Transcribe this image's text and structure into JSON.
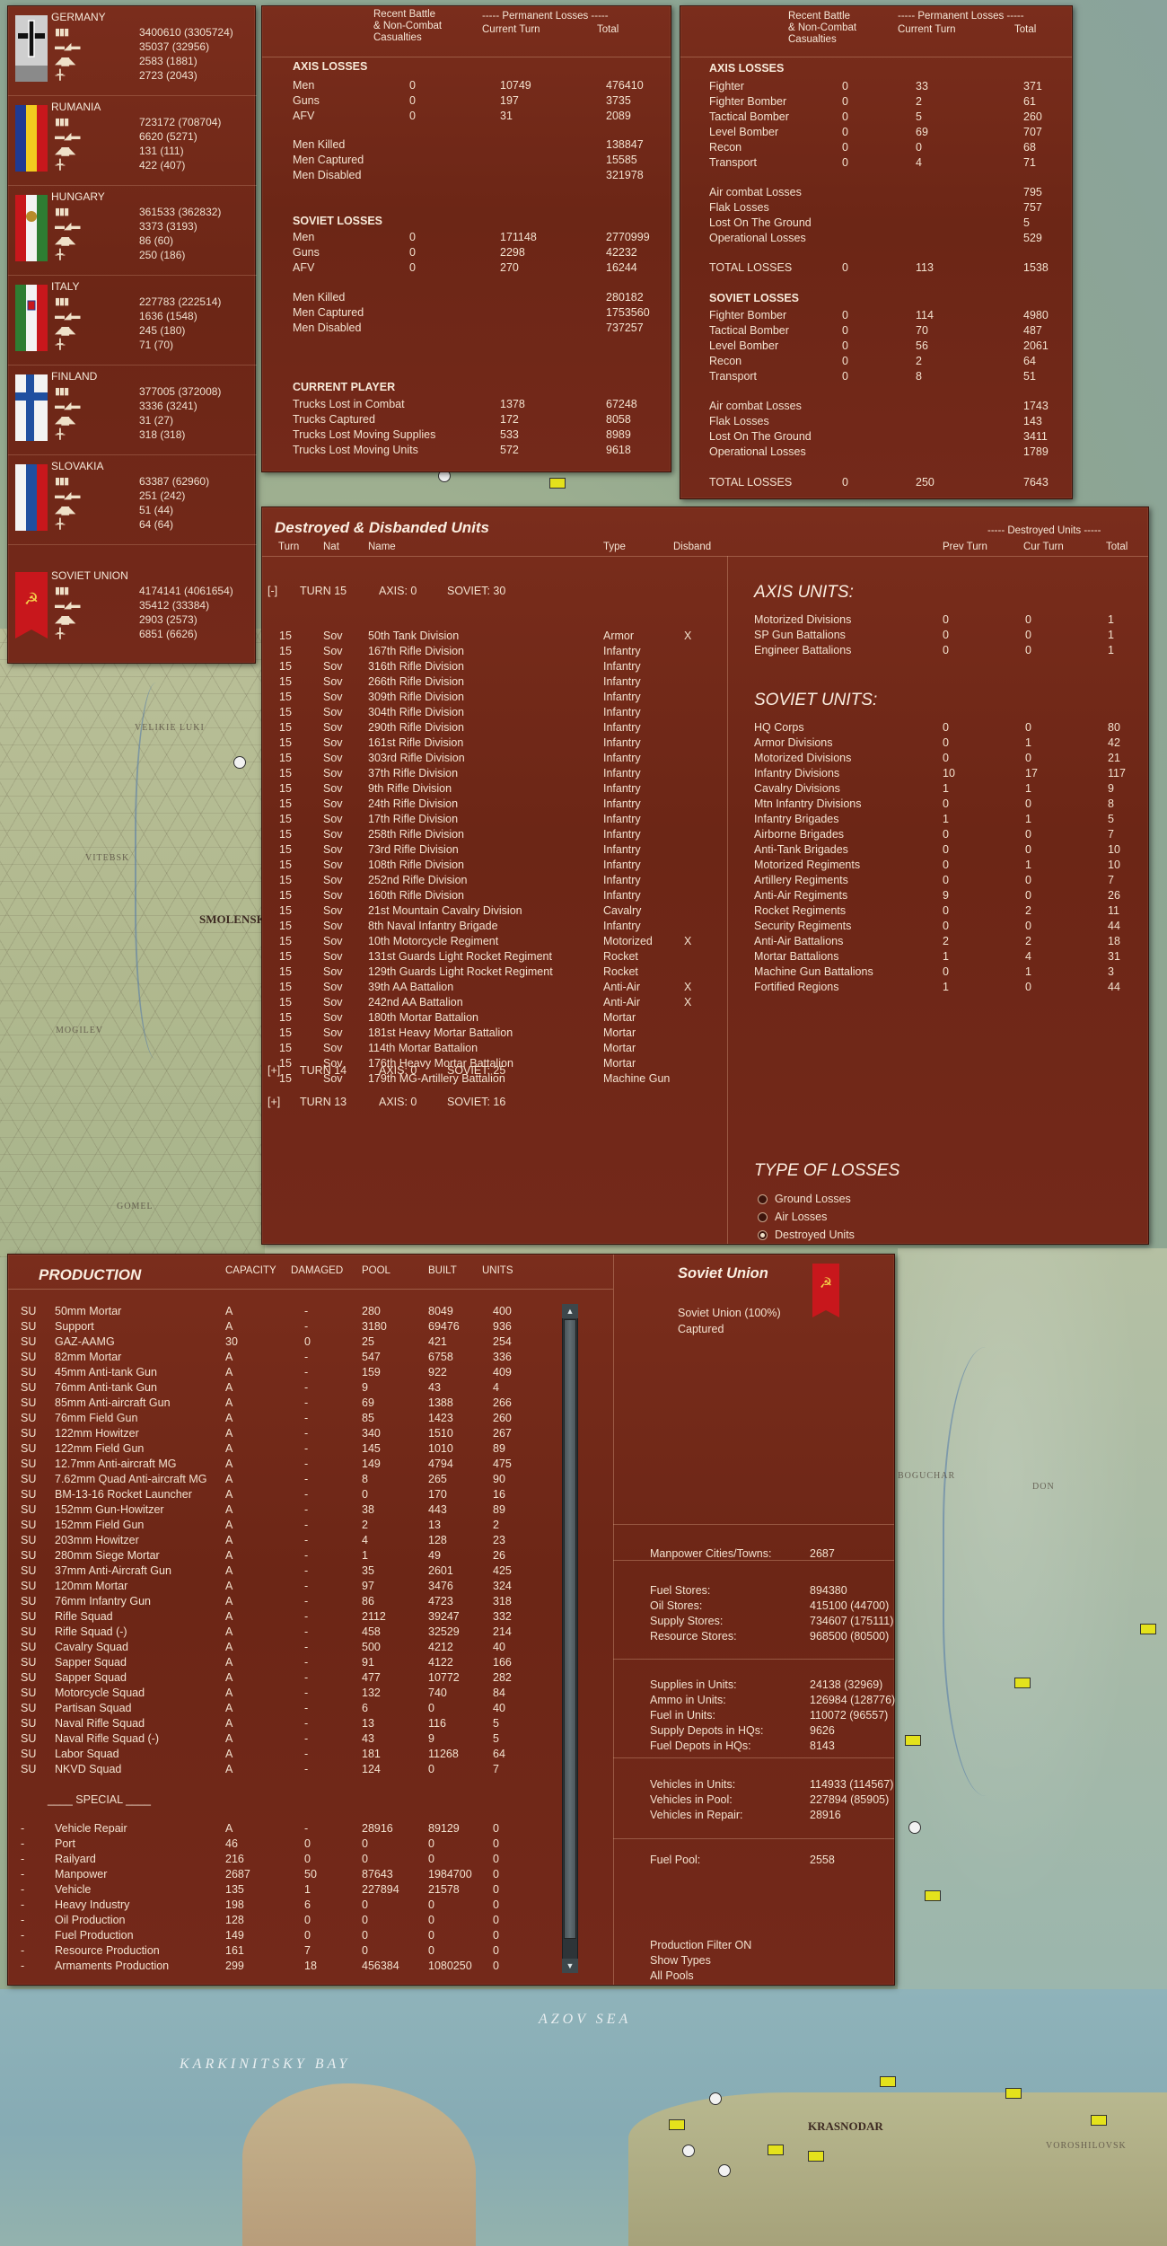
{
  "nations": [
    {
      "name": "GERMANY",
      "flag": "germany",
      "values": [
        "3400610 (3305724)",
        "35037 (32956)",
        "2583 (1881)",
        "2723 (2043)"
      ]
    },
    {
      "name": "RUMANIA",
      "flag": "rumania",
      "values": [
        "723172 (708704)",
        "6620 (5271)",
        "131 (111)",
        "422 (407)"
      ]
    },
    {
      "name": "HUNGARY",
      "flag": "hungary",
      "values": [
        "361533 (362832)",
        "3373 (3193)",
        "86 (60)",
        "250 (186)"
      ]
    },
    {
      "name": "ITALY",
      "flag": "italy",
      "values": [
        "227783 (222514)",
        "1636 (1548)",
        "245 (180)",
        "71 (70)"
      ]
    },
    {
      "name": "FINLAND",
      "flag": "finland",
      "values": [
        "377005 (372008)",
        "3336 (3241)",
        "31 (27)",
        "318 (318)"
      ]
    },
    {
      "name": "SLOVAKIA",
      "flag": "slovakia",
      "values": [
        "63387 (62960)",
        "251 (242)",
        "51 (44)",
        "64 (64)"
      ]
    },
    {
      "name": "SOVIET UNION",
      "flag": "soviet",
      "values": [
        "4174141 (4061654)",
        "35412 (33384)",
        "2903 (2573)",
        "6851 (6626)"
      ]
    }
  ],
  "ground_losses": {
    "header": {
      "recent": "Recent Battle\n& Non-Combat\nCasualties",
      "perm": "----- Permanent Losses -----",
      "cur": "Current Turn",
      "total": "Total"
    },
    "axis_title": "AXIS LOSSES",
    "axis_rows": [
      [
        "Men",
        "0",
        "10749",
        "476410"
      ],
      [
        "Guns",
        "0",
        "197",
        "3735"
      ],
      [
        "AFV",
        "0",
        "31",
        "2089"
      ]
    ],
    "axis_men": [
      [
        "Men Killed",
        "138847"
      ],
      [
        "Men Captured",
        "15585"
      ],
      [
        "Men Disabled",
        "321978"
      ]
    ],
    "soviet_title": "SOVIET LOSSES",
    "soviet_rows": [
      [
        "Men",
        "0",
        "171148",
        "2770999"
      ],
      [
        "Guns",
        "0",
        "2298",
        "42232"
      ],
      [
        "AFV",
        "0",
        "270",
        "16244"
      ]
    ],
    "soviet_men": [
      [
        "Men Killed",
        "280182"
      ],
      [
        "Men Captured",
        "1753560"
      ],
      [
        "Men Disabled",
        "737257"
      ]
    ],
    "player_title": "CURRENT PLAYER",
    "player_rows": [
      [
        "Trucks Lost in Combat",
        "1378",
        "67248"
      ],
      [
        "Trucks Captured",
        "172",
        "8058"
      ],
      [
        "Trucks Lost Moving Supplies",
        "533",
        "8989"
      ],
      [
        "Trucks Lost Moving Units",
        "572",
        "9618"
      ]
    ]
  },
  "air_losses": {
    "header": {
      "recent": "Recent Battle\n& Non-Combat\nCasualties",
      "perm": "----- Permanent Losses -----",
      "cur": "Current Turn",
      "total": "Total"
    },
    "axis_title": "AXIS LOSSES",
    "axis_rows": [
      [
        "Fighter",
        "0",
        "33",
        "371"
      ],
      [
        "Fighter Bomber",
        "0",
        "2",
        "61"
      ],
      [
        "Tactical Bomber",
        "0",
        "5",
        "260"
      ],
      [
        "Level Bomber",
        "0",
        "69",
        "707"
      ],
      [
        "Recon",
        "0",
        "0",
        "68"
      ],
      [
        "Transport",
        "0",
        "4",
        "71"
      ]
    ],
    "axis_sub": [
      [
        "Air combat Losses",
        "795"
      ],
      [
        "Flak Losses",
        "757"
      ],
      [
        "Lost On The Ground",
        "5"
      ],
      [
        "Operational Losses",
        "529"
      ]
    ],
    "axis_total": [
      "TOTAL LOSSES",
      "0",
      "113",
      "1538"
    ],
    "soviet_title": "SOVIET LOSSES",
    "soviet_rows": [
      [
        "Fighter Bomber",
        "0",
        "114",
        "4980"
      ],
      [
        "Tactical Bomber",
        "0",
        "70",
        "487"
      ],
      [
        "Level Bomber",
        "0",
        "56",
        "2061"
      ],
      [
        "Recon",
        "0",
        "2",
        "64"
      ],
      [
        "Transport",
        "0",
        "8",
        "51"
      ]
    ],
    "soviet_sub": [
      [
        "Air combat Losses",
        "1743"
      ],
      [
        "Flak Losses",
        "143"
      ],
      [
        "Lost On The Ground",
        "3411"
      ],
      [
        "Operational Losses",
        "1789"
      ]
    ],
    "soviet_total": [
      "TOTAL LOSSES",
      "0",
      "250",
      "7643"
    ]
  },
  "destroyed": {
    "title": "Destroyed & Disbanded Units",
    "cols": {
      "turn": "Turn",
      "nat": "Nat",
      "name": "Name",
      "type": "Type",
      "disband": "Disband"
    },
    "turn15": {
      "toggle": "[-]",
      "label": "TURN 15",
      "axis": "AXIS: 0",
      "soviet": "SOVIET: 30"
    },
    "units": [
      [
        "15",
        "Sov",
        "50th Tank Division",
        "Armor",
        "X"
      ],
      [
        "15",
        "Sov",
        "167th Rifle Division",
        "Infantry",
        ""
      ],
      [
        "15",
        "Sov",
        "316th Rifle Division",
        "Infantry",
        ""
      ],
      [
        "15",
        "Sov",
        "266th Rifle Division",
        "Infantry",
        ""
      ],
      [
        "15",
        "Sov",
        "309th Rifle Division",
        "Infantry",
        ""
      ],
      [
        "15",
        "Sov",
        "304th Rifle Division",
        "Infantry",
        ""
      ],
      [
        "15",
        "Sov",
        "290th Rifle Division",
        "Infantry",
        ""
      ],
      [
        "15",
        "Sov",
        "161st Rifle Division",
        "Infantry",
        ""
      ],
      [
        "15",
        "Sov",
        "303rd Rifle Division",
        "Infantry",
        ""
      ],
      [
        "15",
        "Sov",
        "37th Rifle Division",
        "Infantry",
        ""
      ],
      [
        "15",
        "Sov",
        "9th Rifle Division",
        "Infantry",
        ""
      ],
      [
        "15",
        "Sov",
        "24th Rifle Division",
        "Infantry",
        ""
      ],
      [
        "15",
        "Sov",
        "17th Rifle Division",
        "Infantry",
        ""
      ],
      [
        "15",
        "Sov",
        "258th Rifle Division",
        "Infantry",
        ""
      ],
      [
        "15",
        "Sov",
        "73rd Rifle Division",
        "Infantry",
        ""
      ],
      [
        "15",
        "Sov",
        "108th Rifle Division",
        "Infantry",
        ""
      ],
      [
        "15",
        "Sov",
        "252nd Rifle Division",
        "Infantry",
        ""
      ],
      [
        "15",
        "Sov",
        "160th Rifle Division",
        "Infantry",
        ""
      ],
      [
        "15",
        "Sov",
        "21st Mountain Cavalry Division",
        "Cavalry",
        ""
      ],
      [
        "15",
        "Sov",
        "8th Naval Infantry Brigade",
        "Infantry",
        ""
      ],
      [
        "15",
        "Sov",
        "10th Motorcycle Regiment",
        "Motorized",
        "X"
      ],
      [
        "15",
        "Sov",
        "131st Guards Light Rocket Regiment",
        "Rocket",
        ""
      ],
      [
        "15",
        "Sov",
        "129th Guards Light Rocket Regiment",
        "Rocket",
        ""
      ],
      [
        "15",
        "Sov",
        "39th AA Battalion",
        "Anti-Air",
        "X"
      ],
      [
        "15",
        "Sov",
        "242nd AA Battalion",
        "Anti-Air",
        "X"
      ],
      [
        "15",
        "Sov",
        "180th Mortar Battalion",
        "Mortar",
        ""
      ],
      [
        "15",
        "Sov",
        "181st Heavy Mortar Battalion",
        "Mortar",
        ""
      ],
      [
        "15",
        "Sov",
        "114th Mortar Battalion",
        "Mortar",
        ""
      ],
      [
        "15",
        "Sov",
        "176th Heavy Mortar Battalion",
        "Mortar",
        ""
      ],
      [
        "15",
        "Sov",
        "179th MG-Artillery Battalion",
        "Machine Gun",
        ""
      ]
    ],
    "turn14": {
      "toggle": "[+]",
      "label": "TURN 14",
      "axis": "AXIS: 0",
      "soviet": "SOVIET: 25"
    },
    "turn13": {
      "toggle": "[+]",
      "label": "TURN 13",
      "axis": "AXIS: 0",
      "soviet": "SOVIET: 16"
    },
    "summary_header": {
      "title": "----- Destroyed Units -----",
      "prev": "Prev Turn",
      "cur": "Cur Turn",
      "total": "Total"
    },
    "axis_units_title": "AXIS UNITS:",
    "axis_units": [
      [
        "Motorized Divisions",
        "0",
        "0",
        "1"
      ],
      [
        "SP Gun Battalions",
        "0",
        "0",
        "1"
      ],
      [
        "Engineer Battalions",
        "0",
        "0",
        "1"
      ]
    ],
    "soviet_units_title": "SOVIET UNITS:",
    "soviet_units": [
      [
        "HQ Corps",
        "0",
        "0",
        "80"
      ],
      [
        "Armor Divisions",
        "0",
        "1",
        "42"
      ],
      [
        "Motorized Divisions",
        "0",
        "0",
        "21"
      ],
      [
        "Infantry Divisions",
        "10",
        "17",
        "117"
      ],
      [
        "Cavalry Divisions",
        "1",
        "1",
        "9"
      ],
      [
        "Mtn Infantry Divisions",
        "0",
        "0",
        "8"
      ],
      [
        "Infantry Brigades",
        "1",
        "1",
        "5"
      ],
      [
        "Airborne Brigades",
        "0",
        "0",
        "7"
      ],
      [
        "Anti-Tank Brigades",
        "0",
        "0",
        "10"
      ],
      [
        "Motorized Regiments",
        "0",
        "1",
        "10"
      ],
      [
        "Artillery Regiments",
        "0",
        "0",
        "7"
      ],
      [
        "Anti-Air Regiments",
        "9",
        "0",
        "26"
      ],
      [
        "Rocket Regiments",
        "0",
        "2",
        "11"
      ],
      [
        "Security Regiments",
        "0",
        "0",
        "44"
      ],
      [
        "Anti-Air Battalions",
        "2",
        "2",
        "18"
      ],
      [
        "Mortar Battalions",
        "1",
        "4",
        "31"
      ],
      [
        "Machine Gun Battalions",
        "0",
        "1",
        "3"
      ],
      [
        "Fortified Regions",
        "1",
        "0",
        "44"
      ]
    ],
    "loss_types_title": "TYPE OF LOSSES",
    "loss_types": [
      {
        "label": "Ground Losses",
        "selected": false
      },
      {
        "label": "Air Losses",
        "selected": false
      },
      {
        "label": "Destroyed Units",
        "selected": true
      }
    ]
  },
  "production": {
    "title": "PRODUCTION",
    "cols": {
      "capacity": "CAPACITY",
      "damaged": "DAMAGED",
      "pool": "POOL",
      "built": "BUILT",
      "units": "UNITS"
    },
    "items": [
      [
        "SU",
        "50mm Mortar",
        "A",
        "-",
        "280",
        "8049",
        "400"
      ],
      [
        "SU",
        "Support",
        "A",
        "-",
        "3180",
        "69476",
        "936"
      ],
      [
        "SU",
        "GAZ-AAMG",
        "30",
        "0",
        "25",
        "421",
        "254"
      ],
      [
        "SU",
        "82mm Mortar",
        "A",
        "-",
        "547",
        "6758",
        "336"
      ],
      [
        "SU",
        "45mm Anti-tank Gun",
        "A",
        "-",
        "159",
        "922",
        "409"
      ],
      [
        "SU",
        "76mm Anti-tank Gun",
        "A",
        "-",
        "9",
        "43",
        "4"
      ],
      [
        "SU",
        "85mm Anti-aircraft Gun",
        "A",
        "-",
        "69",
        "1388",
        "266"
      ],
      [
        "SU",
        "76mm Field Gun",
        "A",
        "-",
        "85",
        "1423",
        "260"
      ],
      [
        "SU",
        "122mm Howitzer",
        "A",
        "-",
        "340",
        "1510",
        "267"
      ],
      [
        "SU",
        "122mm Field Gun",
        "A",
        "-",
        "145",
        "1010",
        "89"
      ],
      [
        "SU",
        "12.7mm Anti-aircraft MG",
        "A",
        "-",
        "149",
        "4794",
        "475"
      ],
      [
        "SU",
        "7.62mm Quad Anti-aircraft MG",
        "A",
        "-",
        "8",
        "265",
        "90"
      ],
      [
        "SU",
        "BM-13-16 Rocket Launcher",
        "A",
        "-",
        "0",
        "170",
        "16"
      ],
      [
        "SU",
        "152mm Gun-Howitzer",
        "A",
        "-",
        "38",
        "443",
        "89"
      ],
      [
        "SU",
        "152mm Field Gun",
        "A",
        "-",
        "2",
        "13",
        "2"
      ],
      [
        "SU",
        "203mm Howitzer",
        "A",
        "-",
        "4",
        "128",
        "23"
      ],
      [
        "SU",
        "280mm Siege Mortar",
        "A",
        "-",
        "1",
        "49",
        "26"
      ],
      [
        "SU",
        "37mm Anti-Aircraft Gun",
        "A",
        "-",
        "35",
        "2601",
        "425"
      ],
      [
        "SU",
        "120mm Mortar",
        "A",
        "-",
        "97",
        "3476",
        "324"
      ],
      [
        "SU",
        "76mm Infantry Gun",
        "A",
        "-",
        "86",
        "4723",
        "318"
      ],
      [
        "SU",
        "Rifle Squad",
        "A",
        "-",
        "2112",
        "39247",
        "332"
      ],
      [
        "SU",
        "Rifle Squad (-)",
        "A",
        "-",
        "458",
        "32529",
        "214"
      ],
      [
        "SU",
        "Cavalry Squad",
        "A",
        "-",
        "500",
        "4212",
        "40"
      ],
      [
        "SU",
        "Sapper Squad",
        "A",
        "-",
        "91",
        "4122",
        "166"
      ],
      [
        "SU",
        "Sapper Squad",
        "A",
        "-",
        "477",
        "10772",
        "282"
      ],
      [
        "SU",
        "Motorcycle Squad",
        "A",
        "-",
        "132",
        "740",
        "84"
      ],
      [
        "SU",
        "Partisan Squad",
        "A",
        "-",
        "6",
        "0",
        "40"
      ],
      [
        "SU",
        "Naval Rifle Squad",
        "A",
        "-",
        "13",
        "116",
        "5"
      ],
      [
        "SU",
        "Naval Rifle Squad (-)",
        "A",
        "-",
        "43",
        "9",
        "5"
      ],
      [
        "SU",
        "Labor Squad",
        "A",
        "-",
        "181",
        "11268",
        "64"
      ],
      [
        "SU",
        "NKVD Squad",
        "A",
        "-",
        "124",
        "0",
        "7"
      ]
    ],
    "special_title": "____ SPECIAL ____",
    "special": [
      [
        "-",
        "Vehicle Repair",
        "A",
        "-",
        "28916",
        "89129",
        "0"
      ],
      [
        "-",
        "Port",
        "46",
        "0",
        "0",
        "0",
        "0"
      ],
      [
        "-",
        "Railyard",
        "216",
        "0",
        "0",
        "0",
        "0"
      ],
      [
        "-",
        "Manpower",
        "2687",
        "50",
        "87643",
        "1984700",
        "0"
      ],
      [
        "-",
        "Vehicle",
        "135",
        "1",
        "227894",
        "21578",
        "0"
      ],
      [
        "-",
        "Heavy Industry",
        "198",
        "6",
        "0",
        "0",
        "0"
      ],
      [
        "-",
        "Oil Production",
        "128",
        "0",
        "0",
        "0",
        "0"
      ],
      [
        "-",
        "Fuel Production",
        "149",
        "0",
        "0",
        "0",
        "0"
      ],
      [
        "-",
        "Resource Production",
        "161",
        "7",
        "0",
        "0",
        "0"
      ],
      [
        "-",
        "Armaments Production",
        "299",
        "18",
        "456384",
        "1080250",
        "0"
      ]
    ],
    "scroll_up": "▲",
    "scroll_down": "▼"
  },
  "soviet_summary": {
    "title": "Soviet Union",
    "ownership": "Soviet Union  (100%)",
    "captured": "Captured",
    "manpower": [
      "Manpower Cities/Towns:",
      "2687"
    ],
    "stores": [
      [
        "Fuel Stores:",
        "894380"
      ],
      [
        "Oil Stores:",
        "415100 (44700)"
      ],
      [
        "Supply Stores:",
        "734607 (175111)"
      ],
      [
        "Resource Stores:",
        "968500 (80500)"
      ]
    ],
    "supplies": [
      [
        "Supplies in Units:",
        "24138 (32969)"
      ],
      [
        "Ammo in Units:",
        "126984 (128776)"
      ],
      [
        "Fuel in Units:",
        "110072 (96557)"
      ],
      [
        "Supply Depots in HQs:",
        "9626"
      ],
      [
        "Fuel Depots in HQs:",
        "8143"
      ]
    ],
    "vehicles": [
      [
        "Vehicles in Units:",
        "114933 (114567)"
      ],
      [
        "Vehicles in Pool:",
        "227894 (85905)"
      ],
      [
        "Vehicles in Repair:",
        "28916"
      ]
    ],
    "fuel_pool": [
      "Fuel Pool:",
      "2558"
    ],
    "filters": [
      "Production Filter ON",
      "Show Types",
      "All Pools"
    ]
  },
  "map": {
    "labels": [
      "Velikie Luki",
      "Vitebsk",
      "Smolensk",
      "Mogilev",
      "Gomel",
      "Azov Sea",
      "Karkinitsky Bay",
      "Krasnodar",
      "Voroshilovsk",
      "Boguchar",
      "Don"
    ]
  },
  "colors": {
    "panel": "#6e2818",
    "soviet_red": "#c8171c",
    "unit_yellow": "#e4e21c"
  }
}
